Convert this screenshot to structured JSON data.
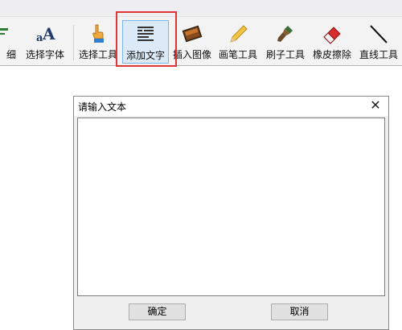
{
  "toolbar": {
    "items": [
      {
        "label": "细",
        "icon": "thickness-icon"
      },
      {
        "label": "选择字体",
        "icon": "font-icon"
      },
      {
        "label": "选择工具",
        "icon": "pointer-hand-icon"
      },
      {
        "label": "添加文字",
        "icon": "add-text-icon",
        "selected": true
      },
      {
        "label": "插入图像",
        "icon": "insert-image-icon"
      },
      {
        "label": "画笔工具",
        "icon": "pencil-icon"
      },
      {
        "label": "刷子工具",
        "icon": "brush-icon"
      },
      {
        "label": "橡皮擦除",
        "icon": "eraser-icon"
      },
      {
        "label": "直线工具",
        "icon": "line-icon"
      }
    ]
  },
  "dialog": {
    "title": "请输入文本",
    "close_glyph": "✕",
    "text_value": "",
    "ok_label": "确定",
    "cancel_label": "取消"
  },
  "colors": {
    "highlight": "#e03535",
    "selected_bg": "#dceaf7",
    "selected_border": "#7eb4ea"
  }
}
